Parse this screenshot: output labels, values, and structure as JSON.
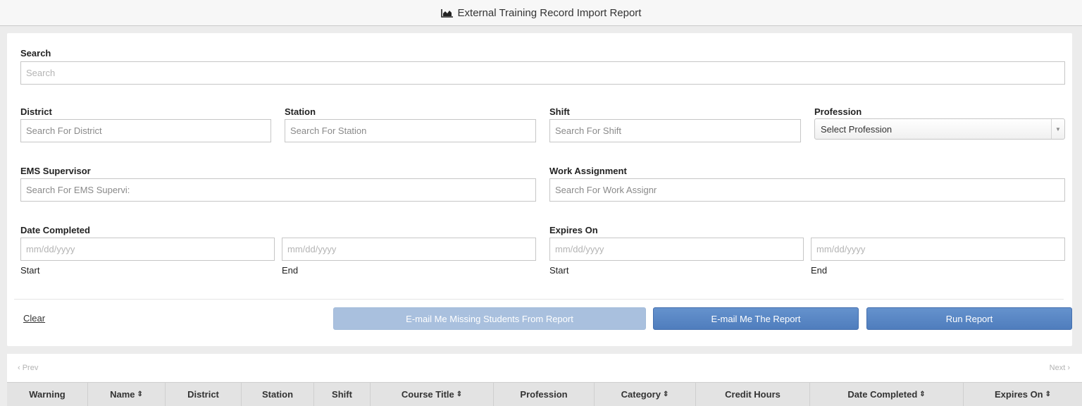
{
  "header": {
    "title": "External Training Record Import Report",
    "icon": "area-chart-icon"
  },
  "filters": {
    "search": {
      "label": "Search",
      "placeholder": "Search"
    },
    "district": {
      "label": "District",
      "placeholder": "Search For District"
    },
    "station": {
      "label": "Station",
      "placeholder": "Search For Station"
    },
    "shift": {
      "label": "Shift",
      "placeholder": "Search For Shift"
    },
    "profession": {
      "label": "Profession",
      "selected": "Select Profession"
    },
    "ems_supervisor": {
      "label": "EMS Supervisor",
      "placeholder": "Search For EMS Supervi:"
    },
    "work_assignment": {
      "label": "Work Assignment",
      "placeholder": "Search For Work Assignr"
    },
    "date_completed": {
      "label": "Date Completed",
      "start_placeholder": "mm/dd/yyyy",
      "end_placeholder": "mm/dd/yyyy",
      "start_label": "Start",
      "end_label": "End"
    },
    "expires_on": {
      "label": "Expires On",
      "start_placeholder": "mm/dd/yyyy",
      "end_placeholder": "mm/dd/yyyy",
      "start_label": "Start",
      "end_label": "End"
    }
  },
  "actions": {
    "clear": "Clear",
    "email_missing": "E-mail Me Missing Students From Report",
    "email_report": "E-mail Me The Report",
    "run_report": "Run Report"
  },
  "pagination": {
    "prev": "‹ Prev",
    "next": "Next ›"
  },
  "table": {
    "columns": [
      {
        "label": "Warning",
        "sortable": false
      },
      {
        "label": "Name",
        "sortable": true
      },
      {
        "label": "District",
        "sortable": false
      },
      {
        "label": "Station",
        "sortable": false
      },
      {
        "label": "Shift",
        "sortable": false
      },
      {
        "label": "Course Title",
        "sortable": true
      },
      {
        "label": "Profession",
        "sortable": false
      },
      {
        "label": "Category",
        "sortable": true
      },
      {
        "label": "Credit Hours",
        "sortable": false
      },
      {
        "label": "Date Completed",
        "sortable": true
      },
      {
        "label": "Expires On",
        "sortable": true
      }
    ],
    "sort_glyph": "⇕"
  },
  "colors": {
    "primary_button": "#5584c4",
    "disabled_button": "#a9c0de",
    "header_bg": "#e3e3e3"
  }
}
